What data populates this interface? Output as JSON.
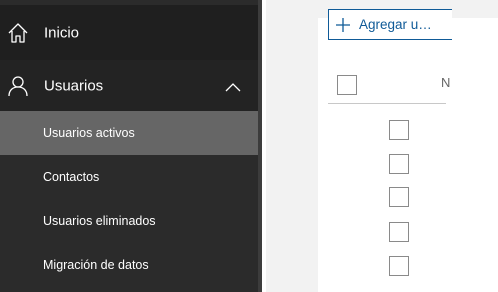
{
  "sidebar": {
    "items": [
      {
        "label": "Inicio",
        "icon": "home-icon"
      },
      {
        "label": "Usuarios",
        "icon": "user-icon",
        "expanded": true
      }
    ],
    "subitems": [
      {
        "label": "Usuarios activos",
        "selected": true
      },
      {
        "label": "Contactos"
      },
      {
        "label": "Usuarios eliminados"
      },
      {
        "label": "Migración de datos"
      }
    ]
  },
  "toolbar": {
    "add_label": "Agregar u…"
  },
  "table": {
    "header_text": "N",
    "row_count": 5
  },
  "colors": {
    "sidebar_bg": "#2b2b2b",
    "selected_bg": "#666666",
    "accent": "#0f5a97"
  }
}
